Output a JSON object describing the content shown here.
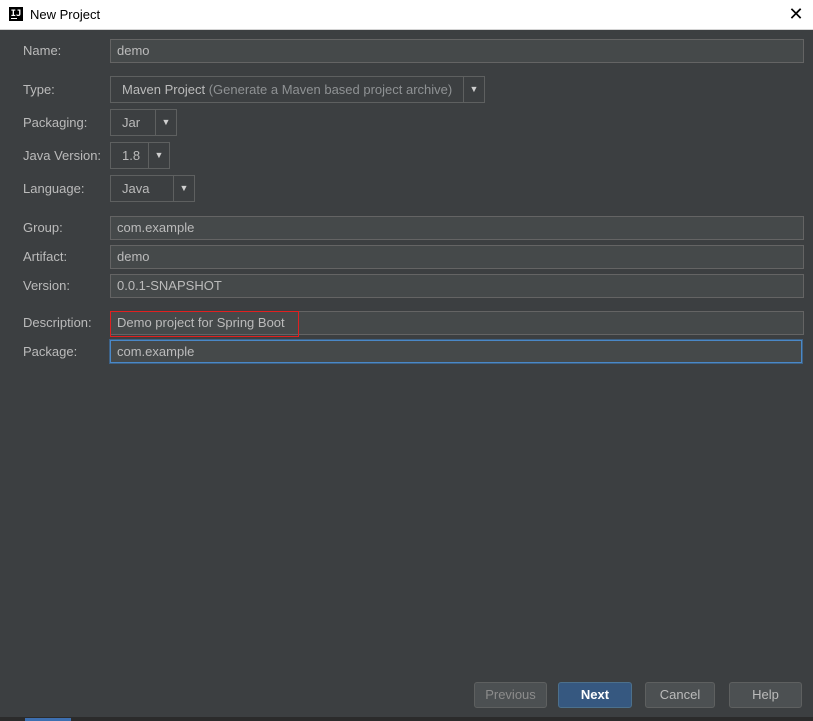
{
  "window": {
    "title": "New Project",
    "close_icon": "close-icon"
  },
  "form": {
    "name": {
      "label": "Name:",
      "value": "demo"
    },
    "type": {
      "label": "Type:",
      "value": "Maven Project",
      "hint": "(Generate a Maven based project archive)"
    },
    "packaging": {
      "label": "Packaging:",
      "value": "Jar"
    },
    "java_version": {
      "label": "Java Version:",
      "value": "1.8"
    },
    "language": {
      "label": "Language:",
      "value": "Java"
    },
    "group": {
      "label": "Group:",
      "value": "com.example"
    },
    "artifact": {
      "label": "Artifact:",
      "value": "demo"
    },
    "version": {
      "label": "Version:",
      "value": "0.0.1-SNAPSHOT"
    },
    "description": {
      "label": "Description:",
      "value": "Demo project for Spring Boot"
    },
    "package": {
      "label": "Package:",
      "value": "com.example"
    }
  },
  "buttons": {
    "previous": "Previous",
    "next": "Next",
    "cancel": "Cancel",
    "help": "Help"
  },
  "colors": {
    "background": "#3c3f41",
    "field_bg": "#45494a",
    "primary": "#365880",
    "highlight": "#e02020",
    "focus": "#4a88c7"
  }
}
